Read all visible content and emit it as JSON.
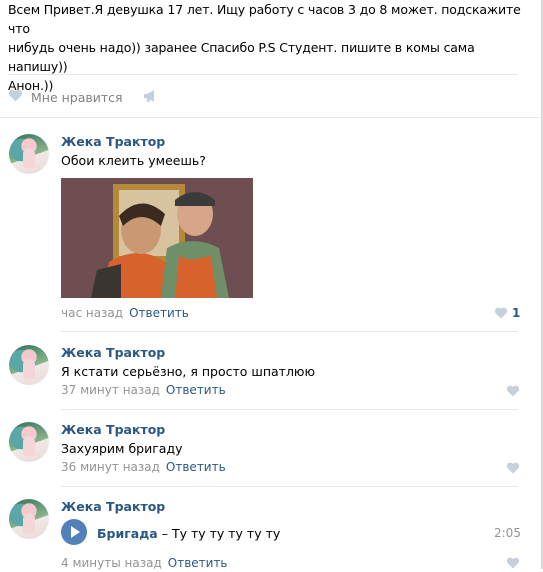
{
  "post": {
    "line1": "Всем Привет.Я девушка 17 лет. Ищу работу с часов 3 до 8 может. подскажите что",
    "line2": "нибудь очень надо)) заранее Спасибо P.S Студент. пишите в комы сама напишу))",
    "line3": "Анон.))",
    "like_label": "Мне нравится",
    "icons": [
      "heart-icon",
      "megaphone-icon"
    ]
  },
  "comments": [
    {
      "author": "Жека Трактор",
      "text": "Обои клеить умеешь?",
      "has_photo": true,
      "time": "час назад",
      "reply": "Ответить",
      "likes": "1"
    },
    {
      "author": "Жека Трактор",
      "text": "Я кстати серьёзно, я просто шпатлюю",
      "time": "37 минут назад",
      "reply": "Ответить"
    },
    {
      "author": "Жека Трактор",
      "text": "Захуярим бригаду",
      "time": "36 минут назад",
      "reply": "Ответить"
    },
    {
      "author": "Жека Трактор",
      "audio": {
        "artist": "Бригада",
        "dash": "–",
        "title": "Ту ту ту ту ту ту",
        "duration": "2:05"
      },
      "time": "4 минуты назад",
      "reply": "Ответить"
    }
  ],
  "colors": {
    "link": "#2a5885",
    "muted": "#939393",
    "separator": "#e7e8ec",
    "play_button": "#5181b8"
  }
}
